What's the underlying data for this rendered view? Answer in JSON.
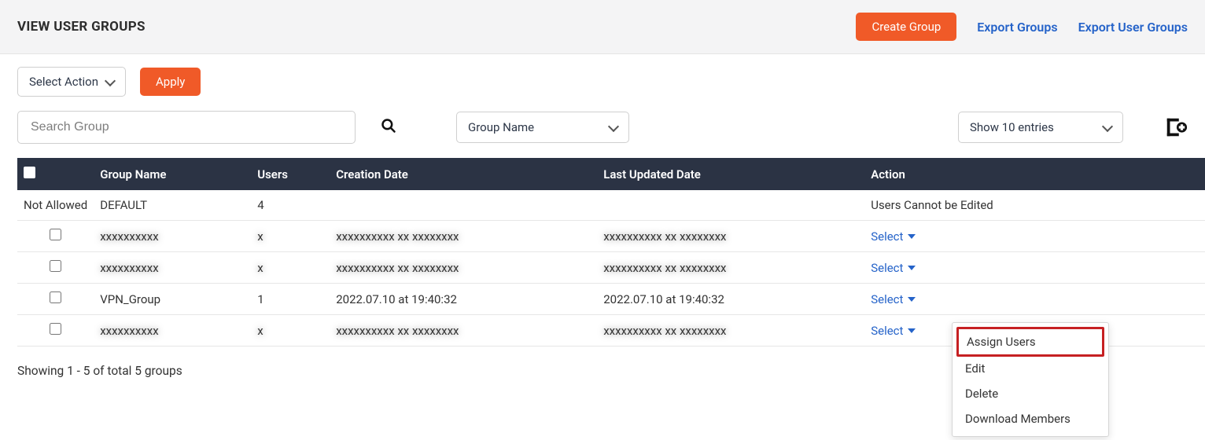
{
  "header": {
    "title": "VIEW USER GROUPS",
    "create_btn": "Create Group",
    "export_groups": "Export Groups",
    "export_user_groups": "Export User Groups"
  },
  "toolbar": {
    "select_action": "Select Action",
    "apply": "Apply",
    "search_placeholder": "Search Group",
    "filter_label": "Group Name",
    "page_size_label": "Show 10 entries"
  },
  "table": {
    "headers": {
      "group_name": "Group Name",
      "users": "Users",
      "creation_date": "Creation Date",
      "last_updated": "Last Updated Date",
      "action": "Action"
    },
    "rows": [
      {
        "check_label": "Not Allowed",
        "name": "DEFAULT",
        "users": "4",
        "created": "",
        "updated": "",
        "action_text": "Users Cannot be Edited",
        "action_type": "static",
        "blurred": false
      },
      {
        "name": "xxxxxxxxxx",
        "users": "x",
        "created": "xxxxxxxxxx xx xxxxxxxx",
        "updated": "xxxxxxxxxx xx xxxxxxxx",
        "action_text": "Select",
        "action_type": "select",
        "blurred": true
      },
      {
        "name": "xxxxxxxxxx",
        "users": "x",
        "created": "xxxxxxxxxx xx xxxxxxxx",
        "updated": "xxxxxxxxxx xx xxxxxxxx",
        "action_text": "Select",
        "action_type": "select",
        "blurred": true
      },
      {
        "name": "VPN_Group",
        "users": "1",
        "created": "2022.07.10 at 19:40:32",
        "updated": "2022.07.10 at 19:40:32",
        "action_text": "Select",
        "action_type": "select",
        "blurred": false
      },
      {
        "name": "xxxxxxxxxx",
        "users": "x",
        "created": "xxxxxxxxxx xx xxxxxxxx",
        "updated": "xxxxxxxxxx xx xxxxxxxx",
        "action_text": "Select",
        "action_type": "select",
        "blurred": true
      }
    ],
    "action_menu": {
      "assign_users": "Assign Users",
      "edit": "Edit",
      "delete": "Delete",
      "download_members": "Download Members"
    }
  },
  "footer": {
    "summary": "Showing 1 - 5 of total 5 groups"
  }
}
